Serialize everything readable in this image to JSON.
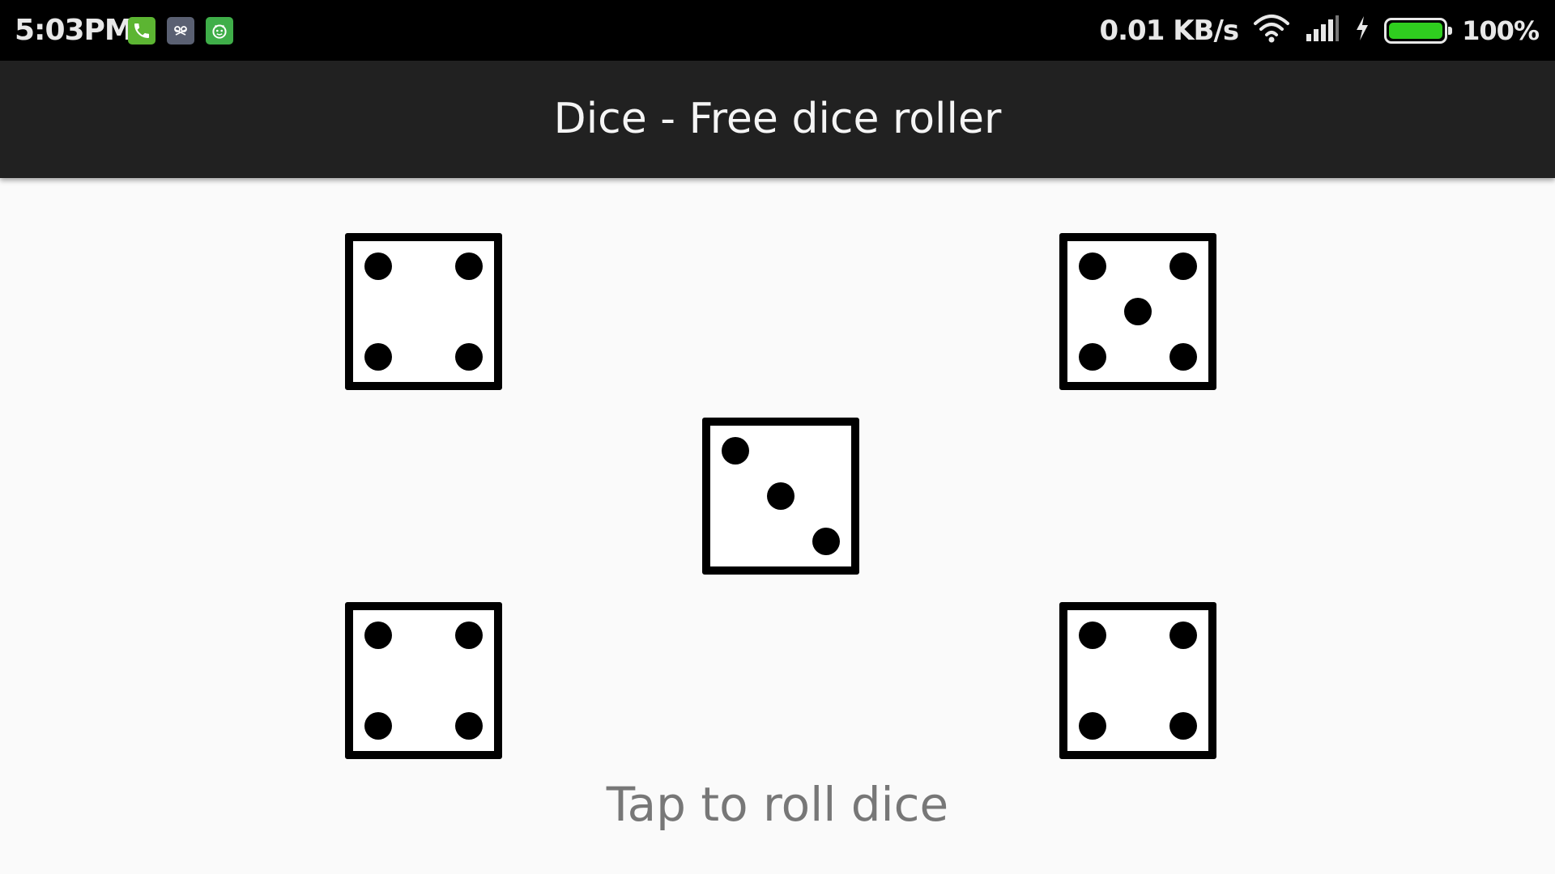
{
  "status_bar": {
    "time": "5:03PM",
    "notification_icons": [
      "phone-icon",
      "cat-app-icon",
      "android-app-icon"
    ],
    "net_speed": "0.01 KB/s",
    "battery_level": 1.0,
    "battery_percent": "100%",
    "battery_color": "#2fce1f"
  },
  "app_bar": {
    "title": "Dice - Free dice roller"
  },
  "dice": [
    4,
    5,
    3,
    4,
    4
  ],
  "hint": "Tap to roll dice"
}
